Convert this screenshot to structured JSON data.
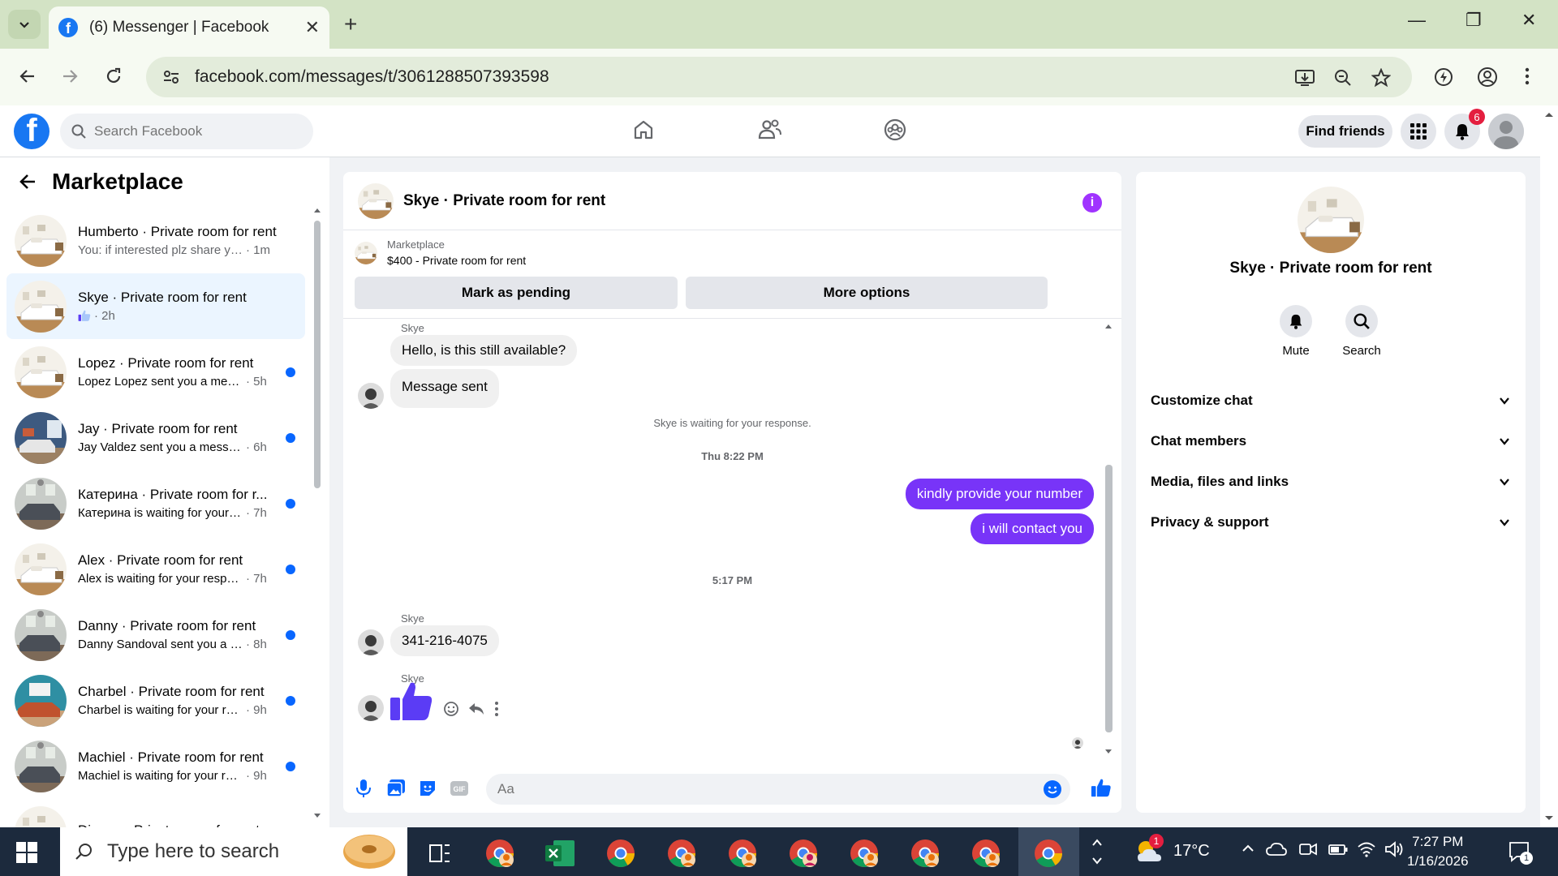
{
  "browser": {
    "tab_title": "(6) Messenger | Facebook",
    "tab_close": "✕",
    "new_tab": "+",
    "url": "facebook.com/messages/t/3061288507393598",
    "window_controls": {
      "minimize": "—",
      "maximize": "❐",
      "close": "✕"
    }
  },
  "fb_header": {
    "logo": "f",
    "search_placeholder": "Search Facebook",
    "find_friends": "Find friends",
    "notification_count": "6"
  },
  "left_pane": {
    "title": "Marketplace",
    "chats": [
      {
        "name": "Humberto · Private room for rent",
        "preview": "You: if interested plz share your c...",
        "time": "· 1m",
        "unread": false
      },
      {
        "name": "Skye · Private room for rent",
        "preview": "",
        "time": "· 2h",
        "unread": false,
        "selected": true,
        "like": true
      },
      {
        "name": "Lopez · Private room for rent",
        "preview": "Lopez Lopez sent you a messag...",
        "time": "· 5h",
        "unread": true
      },
      {
        "name": "Jay · Private room for rent",
        "preview": "Jay Valdez sent you a message ...",
        "time": "· 6h",
        "unread": true
      },
      {
        "name": "Катерина · Private room for r...",
        "preview": "Катерина is waiting for your re...",
        "time": "· 7h",
        "unread": true
      },
      {
        "name": "Alex · Private room for rent",
        "preview": "Alex is waiting for your respon...",
        "time": "· 7h",
        "unread": true
      },
      {
        "name": "Danny · Private room for rent",
        "preview": "Danny Sandoval sent you a me...",
        "time": "· 8h",
        "unread": true
      },
      {
        "name": "Charbel · Private room for rent",
        "preview": "Charbel is waiting for your res...",
        "time": "· 9h",
        "unread": true
      },
      {
        "name": "Machiel · Private room for rent",
        "preview": "Machiel is waiting for your res...",
        "time": "· 9h",
        "unread": true
      },
      {
        "name": "Dianne · Private room for rent",
        "preview": "",
        "time": "",
        "unread": true
      }
    ]
  },
  "conversation": {
    "title": "Skye · Private room for rent",
    "info_icon": "i",
    "marketplace_label": "Marketplace",
    "listing": "$400 - Private room for rent",
    "mark_pending": "Mark as pending",
    "more_options": "More options",
    "messages": {
      "sender1": "Skye",
      "msg1": "Hello, is this still available?",
      "msg2": "Message sent",
      "waiting": "Skye is waiting for your response.",
      "time1": "Thu 8:22 PM",
      "out1": "kindly provide your number",
      "out2": "i will contact you",
      "time2": "5:17 PM",
      "sender2": "Skye",
      "msg3": "341-216-4075",
      "sender3": "Skye"
    },
    "composer_placeholder": "Aa"
  },
  "right_pane": {
    "title": "Skye · Private room for rent",
    "mute": "Mute",
    "search": "Search",
    "sections": [
      "Customize chat",
      "Chat members",
      "Media, files and links",
      "Privacy & support"
    ]
  },
  "taskbar": {
    "search_placeholder": "Type here to search",
    "weather": "17°C",
    "weather_badge": "1",
    "time": "7:27 PM",
    "date": "1/16/2026",
    "notification_badge": "1"
  },
  "colors": {
    "fb_blue": "#1877f2",
    "chat_purple": "#7834f8",
    "like_purple": "#5b3cf5",
    "unread_blue": "#0866ff"
  }
}
